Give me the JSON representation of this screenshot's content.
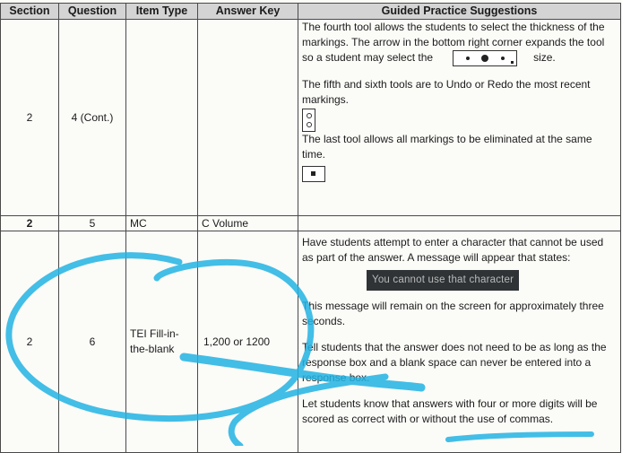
{
  "headers": [
    "Section",
    "Question",
    "Item Type",
    "Answer Key",
    "Guided Practice Suggestions"
  ],
  "row1": {
    "section": "2",
    "question": "4 (Cont.)",
    "item_type": "",
    "answer_key": "",
    "p1a": "The fourth tool allows the students to select the thickness of the markings. The arrow in the bottom right corner expands the tool so a student may select the",
    "p1b": "size.",
    "p2": "The fifth and sixth tools are to Undo or Redo the most recent markings.",
    "p3": "The last tool allows all markings to be eliminated at the same time."
  },
  "row2": {
    "section": "2",
    "question": "5",
    "item_type": "MC",
    "answer_key": "C Volume",
    "guide": ""
  },
  "row3": {
    "section": "2",
    "question": "6",
    "item_type": "TEI Fill-in-the-blank",
    "answer_key": "1,200 or 1200",
    "p1": "Have students attempt to enter a character that cannot be used as part of the answer.  A message will appear that states:",
    "message": "You cannot use that character",
    "p2": "This message will remain on the screen for approximately three seconds.",
    "p3": "Tell students that the answer does not need to be as long as the response box and a blank space can never be entered into a response box.",
    "p4": "Let students know that answers with four or more digits will be scored as correct with or without the use of commas."
  },
  "colors": {
    "header_bg": "#d4d4d4",
    "highlighter": "#22b3e3"
  }
}
